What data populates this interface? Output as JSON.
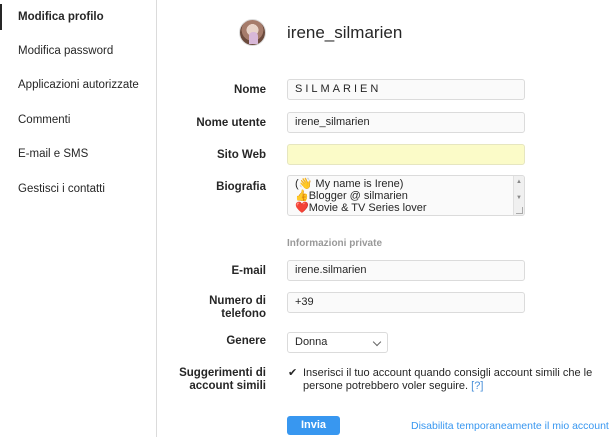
{
  "sidebar": {
    "items": [
      {
        "label": "Modifica profilo",
        "active": true
      },
      {
        "label": "Modifica password"
      },
      {
        "label": "Applicazioni autorizzate"
      },
      {
        "label": "Commenti"
      },
      {
        "label": "E-mail e SMS"
      },
      {
        "label": "Gestisci i contatti"
      }
    ]
  },
  "profile": {
    "username": "irene_silmarien"
  },
  "form": {
    "name": {
      "label": "Nome",
      "value": "SILMARIEN"
    },
    "username": {
      "label": "Nome utente",
      "value": "irene_silmarien"
    },
    "website": {
      "label": "Sito Web",
      "value": ""
    },
    "bio": {
      "label": "Biografia",
      "lines": [
        "(👋 My name is Irene)",
        "👍Blogger @ silmarien",
        "❤️Movie & TV Series lover"
      ]
    },
    "private_section_title": "Informazioni private",
    "email": {
      "label": "E-mail",
      "value": "irene.silmarien"
    },
    "phone": {
      "label_line1": "Numero di",
      "label_line2": "telefono",
      "value": "+39"
    },
    "gender": {
      "label": "Genere",
      "value": "Donna"
    },
    "suggestions": {
      "label_line1": "Suggerimenti di",
      "label_line2": "account simili",
      "checked": true,
      "text": "Inserisci il tuo account quando consigli account simili che le persone potrebbero voler seguire.",
      "help": "[?]"
    },
    "submit_label": "Invia",
    "disable_link": "Disabilita temporaneamente il mio account"
  },
  "colors": {
    "accent": "#3897f0",
    "website_field_bg": "#fbfbc8",
    "border": "#dbdbdb"
  }
}
